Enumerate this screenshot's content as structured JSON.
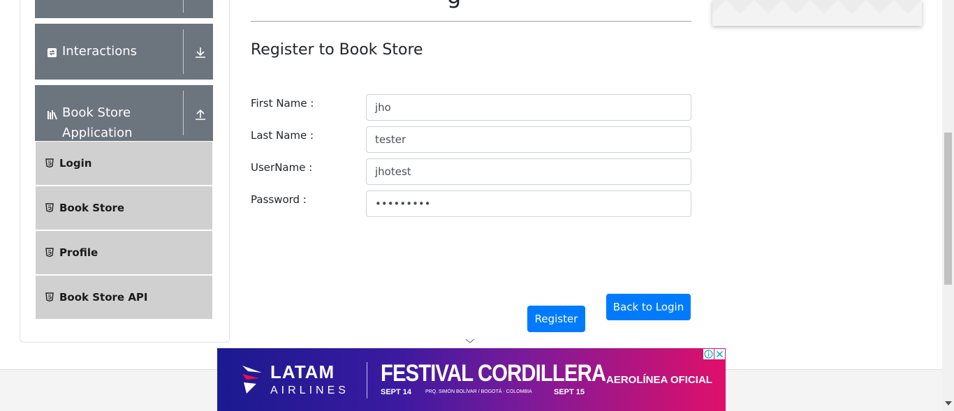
{
  "sidebar": {
    "groups": [
      {
        "label": ""
      },
      {
        "label": "Interactions"
      },
      {
        "label": "Book Store",
        "label_line2": "Application"
      }
    ],
    "items": [
      {
        "label": "Login"
      },
      {
        "label": "Book Store"
      },
      {
        "label": "Profile"
      },
      {
        "label": "Book Store API"
      }
    ]
  },
  "header": {
    "title_fragment": "g"
  },
  "form": {
    "title": "Register to Book Store",
    "fields": [
      {
        "label": "First Name :",
        "value": "jho"
      },
      {
        "label": "Last Name :",
        "value": "tester"
      },
      {
        "label": "UserName :",
        "value": "jhotest"
      },
      {
        "label": "Password :",
        "value": "•••••••••"
      }
    ],
    "register_label": "Register",
    "back_label": "Back to Login"
  },
  "ad": {
    "brand": "LATAM",
    "brand_sub": "AIRLINES",
    "headline": "FESTIVAL CORDILLERA",
    "date_start": "SEPT 14",
    "place": "PRQ. SIMÓN BOLÍVAR / BOGOTÁ · COLOMBIA",
    "date_end": "SEPT 15",
    "tagline": "AEROLÍNEA OFICIAL"
  },
  "colors": {
    "sidebar_header": "#6c757d",
    "sidebar_item": "#d0d0d0",
    "primary_button": "#007bff"
  }
}
